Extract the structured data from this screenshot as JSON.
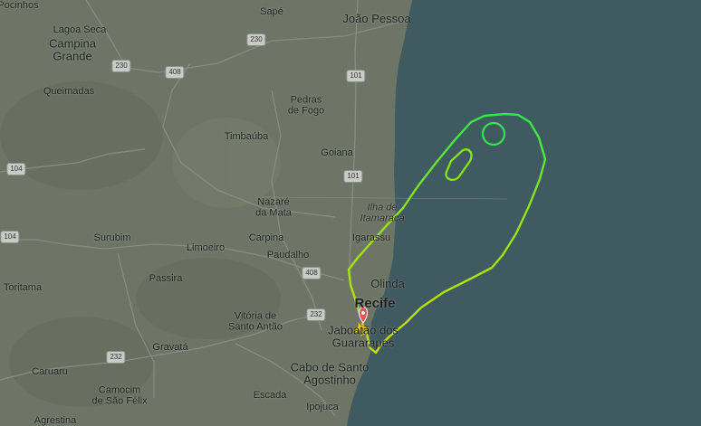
{
  "map": {
    "places": [
      {
        "id": "pocinhos",
        "text": "Pocinhos",
        "size": "sm"
      },
      {
        "id": "sape",
        "text": "Sapé",
        "size": "sm"
      },
      {
        "id": "joao-pessoa",
        "text": "João Pessoa",
        "size": "md"
      },
      {
        "id": "lagoa-seca",
        "text": "Lagoa Seca",
        "size": "sm"
      },
      {
        "id": "campina-grande",
        "text": "Campina\nGrande",
        "size": "md"
      },
      {
        "id": "queimadas",
        "text": "Queimadas",
        "size": "sm"
      },
      {
        "id": "pedras-de-fogo",
        "text": "Pedras\nde Fogo",
        "size": "sm"
      },
      {
        "id": "timbauba",
        "text": "Timbaúba",
        "size": "sm"
      },
      {
        "id": "goiana",
        "text": "Goiana",
        "size": "sm"
      },
      {
        "id": "nazare-da-mata",
        "text": "Nazaré\nda Mata",
        "size": "sm"
      },
      {
        "id": "ilha-de-itamaraca",
        "text": "Ilha de\nItamaracá",
        "size": "it"
      },
      {
        "id": "surubim",
        "text": "Surubim",
        "size": "sm"
      },
      {
        "id": "limoeiro",
        "text": "Limoeiro",
        "size": "sm"
      },
      {
        "id": "carpina",
        "text": "Carpina",
        "size": "sm"
      },
      {
        "id": "igarassu",
        "text": "Igarassu",
        "size": "sm"
      },
      {
        "id": "toritama",
        "text": "Toritama",
        "size": "sm"
      },
      {
        "id": "passira",
        "text": "Passira",
        "size": "sm"
      },
      {
        "id": "paudalho",
        "text": "Paudalho",
        "size": "sm"
      },
      {
        "id": "olinda",
        "text": "Olinda",
        "size": "md"
      },
      {
        "id": "recife",
        "text": "Recife",
        "size": "lg"
      },
      {
        "id": "vitoria-de-santo-antao",
        "text": "Vitória de\nSanto Antão",
        "size": "sm"
      },
      {
        "id": "jaboatao-dos-guararapes",
        "text": "Jaboatão dos\nGuararapes",
        "size": "md"
      },
      {
        "id": "gravata",
        "text": "Gravatá",
        "size": "sm"
      },
      {
        "id": "caruaru",
        "text": "Caruaru",
        "size": "sm"
      },
      {
        "id": "cabo-de-santo-agostinho",
        "text": "Cabo de Santo\nAgostinho",
        "size": "md"
      },
      {
        "id": "camocim-de-sao-felix",
        "text": "Camocim\nde São Félix",
        "size": "sm"
      },
      {
        "id": "escada",
        "text": "Escada",
        "size": "sm"
      },
      {
        "id": "ipojuca",
        "text": "Ipojuca",
        "size": "sm"
      },
      {
        "id": "agrestina",
        "text": "Agrestina",
        "size": "sm"
      }
    ],
    "shields": [
      {
        "id": "br230-a",
        "text": "230"
      },
      {
        "id": "br230-b",
        "text": "230"
      },
      {
        "id": "br408-a",
        "text": "408"
      },
      {
        "id": "br101-a",
        "text": "101"
      },
      {
        "id": "br101-b",
        "text": "101"
      },
      {
        "id": "br104-a",
        "text": "104"
      },
      {
        "id": "br104-b",
        "text": "104"
      },
      {
        "id": "br408-b",
        "text": "408"
      },
      {
        "id": "br232-a",
        "text": "232"
      },
      {
        "id": "br232-b",
        "text": "232"
      }
    ],
    "colors": {
      "land": "#6d7566",
      "ocean": "#3f5a60",
      "road": "#8d9088",
      "track_start": "#c9e000",
      "track_end": "#2fe84a",
      "plane": "#f2d200",
      "marker": "#e8505b"
    },
    "icons": {
      "plane": "airplane-icon",
      "marker": "map-pin-icon"
    }
  }
}
